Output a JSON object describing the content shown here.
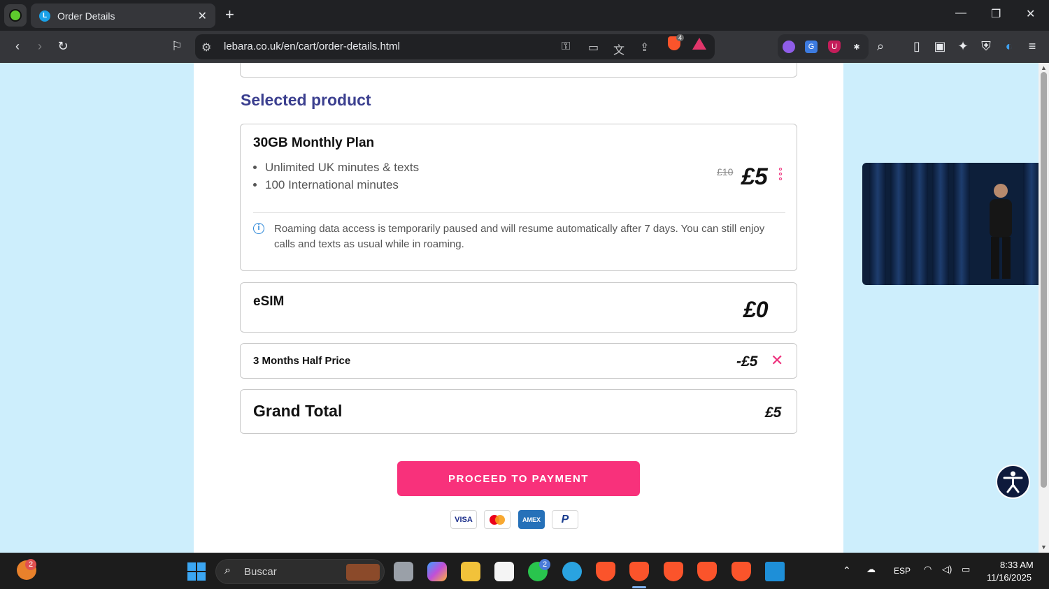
{
  "browser": {
    "tab_title": "Order Details",
    "tab_favicon_letter": "L",
    "url": "lebara.co.uk/en/cart/order-details.html",
    "shields_count": "4"
  },
  "order": {
    "section_title": "Selected product",
    "plan": {
      "name": "30GB Monthly Plan",
      "features": [
        "Unlimited UK minutes & texts",
        "100 International minutes"
      ],
      "old_price": "£10",
      "price": "£5",
      "notice": "Roaming data access is temporarily paused and will resume automatically after 7 days. You can still enjoy calls and texts as usual while in roaming."
    },
    "esim": {
      "label": "eSIM",
      "price": "£0"
    },
    "discount": {
      "label": "3 Months Half Price",
      "value": "-£5"
    },
    "total": {
      "label": "Grand Total",
      "value": "£5"
    },
    "cta": "PROCEED TO PAYMENT",
    "payment_methods": [
      "VISA",
      "Mastercard",
      "AMEX",
      "PayPal"
    ],
    "payment_labels": {
      "visa": "VISA",
      "amex": "AMEX"
    }
  },
  "taskbar": {
    "search_placeholder": "Buscar",
    "notif_badge": "2",
    "whatsapp_badge": "2",
    "language": "ESP",
    "time": "8:33 AM",
    "date": "11/16/2025"
  },
  "colors": {
    "brand_pink": "#f8317b",
    "heading_navy": "#3b3f8f",
    "viewport_bg": "#cdeefc"
  }
}
